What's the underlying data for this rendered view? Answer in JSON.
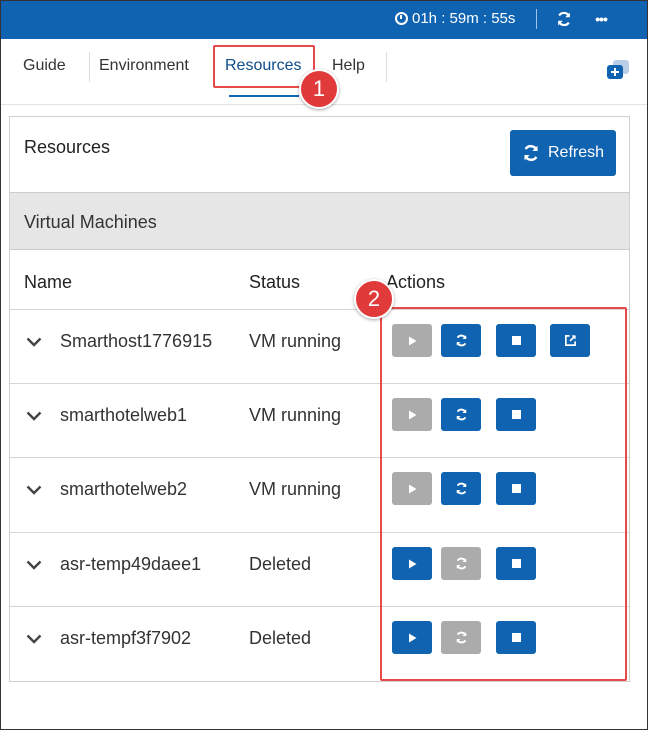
{
  "timer": {
    "text": "01h : 59m : 55s"
  },
  "topbar": {
    "refresh_icon": "refresh-icon",
    "more_icon": "more-icon",
    "more_label": "•••"
  },
  "tabs": [
    {
      "label": "Guide"
    },
    {
      "label": "Environment"
    },
    {
      "label": "Resources",
      "active": true
    },
    {
      "label": "Help"
    }
  ],
  "annotations": {
    "badge1": "1",
    "badge2": "2"
  },
  "panel": {
    "title": "Resources",
    "refresh_label": "Refresh",
    "section_title": "Virtual Machines",
    "columns": {
      "name": "Name",
      "status": "Status",
      "actions": "Actions"
    },
    "rows": [
      {
        "name": "Smarthost1776915",
        "status": "VM running",
        "actions": [
          "start-disabled",
          "restart",
          "stop",
          "open"
        ]
      },
      {
        "name": "smarthotelweb1",
        "status": "VM running",
        "actions": [
          "start-disabled",
          "restart",
          "stop"
        ]
      },
      {
        "name": "smarthotelweb2",
        "status": "VM running",
        "actions": [
          "start-disabled",
          "restart",
          "stop"
        ]
      },
      {
        "name": "asr-temp49daee1",
        "status": "Deleted",
        "actions": [
          "start",
          "restart-disabled",
          "stop"
        ]
      },
      {
        "name": "asr-tempf3f7902",
        "status": "Deleted",
        "actions": [
          "start",
          "restart-disabled",
          "stop"
        ]
      }
    ]
  },
  "colors": {
    "primary": "#0f63b0",
    "disabled": "#ababab",
    "highlight": "#e84a4a",
    "badge": "#e03a3a"
  }
}
